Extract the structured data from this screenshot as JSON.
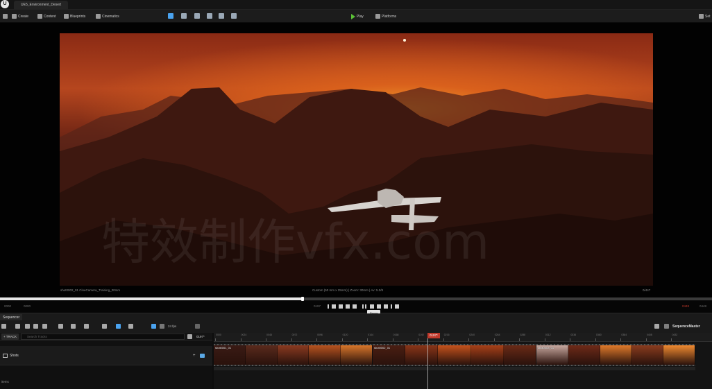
{
  "window": {
    "tab_title": "UE5_Environment_Desert"
  },
  "toolbar": {
    "create_label": "Create",
    "content_label": "Content",
    "blueprints_label": "Blueprints",
    "cinematics_label": "Cinematics",
    "play_label": "Play",
    "platforms_label": "Platforms",
    "settings_label": "Set"
  },
  "viewport": {
    "left_label": "shot0002_01 CineCamera_Training_30mm",
    "center_label": "Custom (50 mm x 25mm) | Zoom: 30mm | Av: 5.0/8",
    "right_label": "0/447"
  },
  "transport": {
    "start_time_1": "0000",
    "start_time_2": "0000",
    "current_frame": "0197",
    "end_time_1": "0448",
    "end_time_2": "0448",
    "tooltip": "Pause",
    "scrub_progress": 0.425
  },
  "sequencer": {
    "tab_label": "Sequencer",
    "fps_label": "24 fps",
    "sequence_name": "SequenceMaster",
    "add_track_label": "+ TRACK",
    "search_placeholder": "Search Tracks",
    "frame_value": "0197*",
    "playhead_label": "0197*",
    "track_name": "Shots",
    "items_label": "items",
    "ruler_labels": [
      "0000",
      "0024",
      "0048",
      "0072",
      "0096",
      "0120",
      "0144",
      "0168",
      "0192",
      "0216",
      "0240",
      "0264",
      "0288",
      "0312",
      "0336",
      "0360",
      "0384",
      "0408",
      "0432"
    ],
    "shots": [
      {
        "name": "shot0001_01",
        "start": 0,
        "end": 0.33
      },
      {
        "name": "shot0002_01",
        "start": 0.33,
        "end": 0.67
      },
      {
        "name": "shot0003_01",
        "start": 0.67,
        "end": 1.0
      }
    ]
  }
}
